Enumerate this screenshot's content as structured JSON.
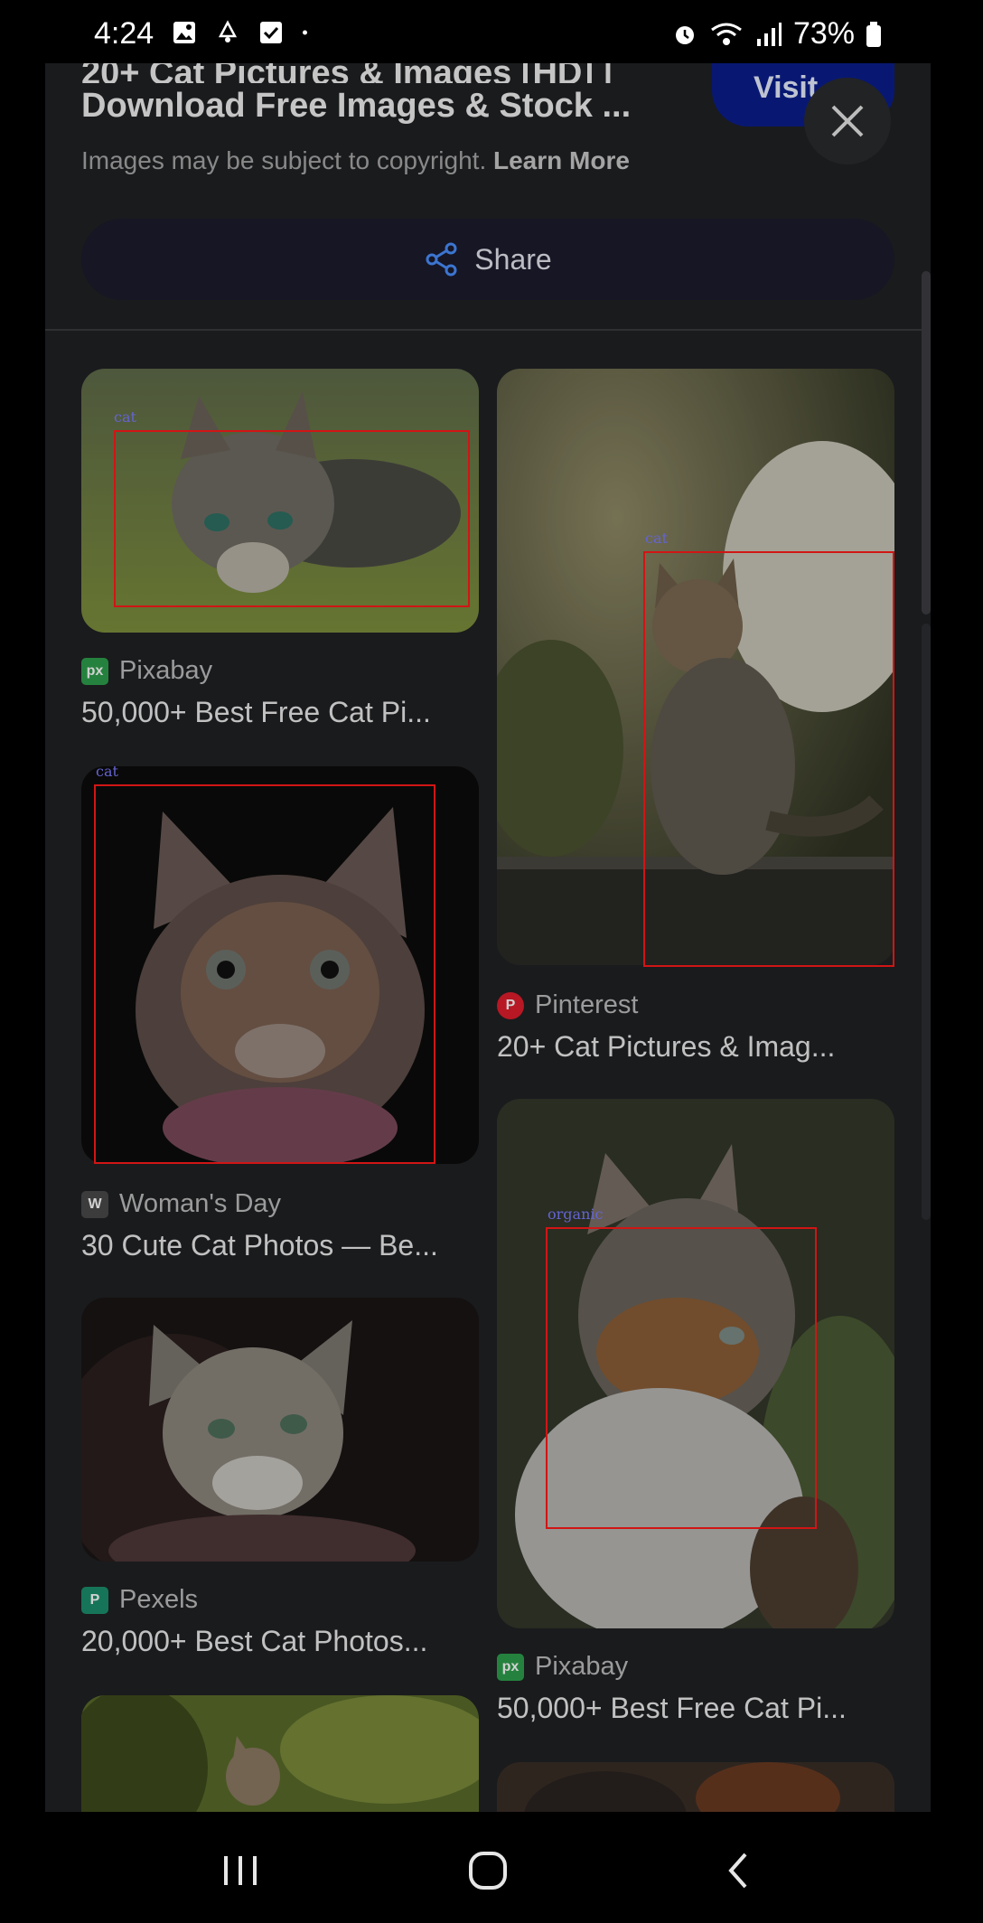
{
  "status_bar": {
    "time": "4:24",
    "battery": "73%",
    "left_icons": [
      "image-icon",
      "notification-icon",
      "checkbox-icon",
      "dot-icon"
    ],
    "right_icons": [
      "alarm-icon",
      "wifi-icon",
      "signal-icon",
      "battery-icon"
    ]
  },
  "header": {
    "title_line1": "20+ Cat Pictures & Images [HD] |",
    "title_line2": "Download Free Images & Stock ...",
    "copyright_text": "Images may be subject to copyright.",
    "learn_more": "Learn More",
    "visit_label": "Visit",
    "share_label": "Share"
  },
  "results": [
    {
      "source": "Pixabay",
      "title": "50,000+ Best Free Cat Pi...",
      "detection": "cat",
      "icon_color": "#2e9f4c"
    },
    {
      "source": "Woman's Day",
      "title": "30 Cute Cat Photos — Be...",
      "detection": "cat",
      "icon_color": "#4a4a4a"
    },
    {
      "source": "Pexels",
      "title": "20,000+ Best Cat Photos...",
      "detection": "",
      "icon_color": "#1c8f6c"
    },
    {
      "source": "Pinterest",
      "title": "20+ Cat Pictures & Imag...",
      "detection": "cat",
      "icon_color": "#e01e2c"
    },
    {
      "source": "Pixabay",
      "title": "50,000+ Best Free Cat Pi...",
      "detection": "organic",
      "icon_color": "#2e9f4c"
    }
  ],
  "colors": {
    "background": "#202124",
    "visit_button": "#0a1e8c",
    "share_button": "#1b1c2c",
    "detection_box": "#ff1a1a"
  }
}
